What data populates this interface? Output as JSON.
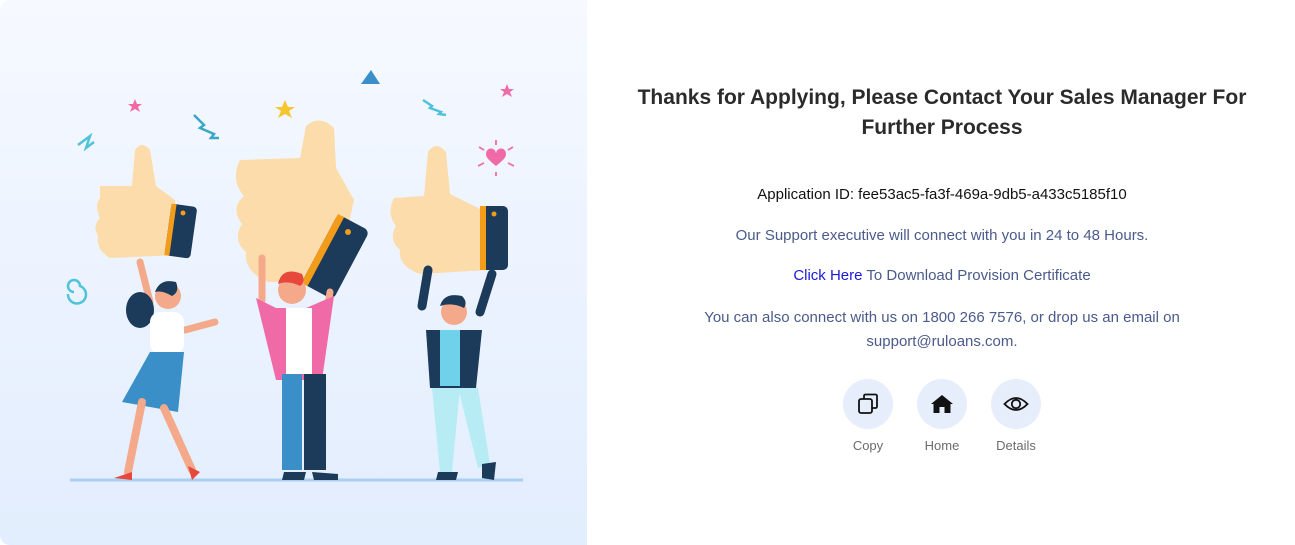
{
  "message": {
    "title": "Thanks for Applying, Please Contact Your Sales Manager For Further Process",
    "application_id_label": "Application ID: fee53ac5-fa3f-469a-9db5-a433c5185f10",
    "support_text": "Our Support executive will connect with you in 24 to 48 Hours.",
    "download_link": "Click Here",
    "download_text": " To Download Provision Certificate",
    "contact_text": "You can also connect with us on 1800 266 7576, or drop us an email on support@ruloans.com."
  },
  "actions": [
    {
      "label": "Copy",
      "icon": "copy-icon"
    },
    {
      "label": "Home",
      "icon": "home-icon"
    },
    {
      "label": "Details",
      "icon": "eye-icon"
    }
  ],
  "colors": {
    "accent_link": "#1a1ad6",
    "action_circle": "#e6eefc",
    "illustration_bg": "#eaf2ff"
  }
}
